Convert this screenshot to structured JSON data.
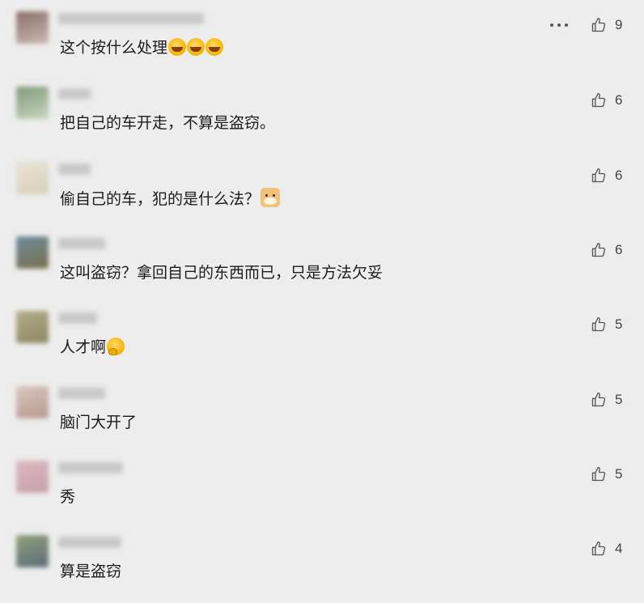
{
  "comments": [
    {
      "text": "这个按什么处理",
      "emojis": [
        "laugh",
        "laugh",
        "laugh"
      ],
      "likes": "9",
      "has_more": true,
      "avatar_colors": [
        "#8a6f6a",
        "#c9b8b0"
      ]
    },
    {
      "text": "把自己的车开走，不算是盗窃。",
      "emojis": [],
      "likes": "6",
      "has_more": false,
      "avatar_colors": [
        "#7f9a7a",
        "#c8d6c0"
      ]
    },
    {
      "text": "偷自己的车，犯的是什么法？",
      "emojis": [
        "dog"
      ],
      "likes": "6",
      "has_more": false,
      "avatar_colors": [
        "#e9e3d6",
        "#d8cfba"
      ]
    },
    {
      "text": "这叫盗窃？拿回自己的东西而已，只是方法欠妥",
      "emojis": [],
      "likes": "6",
      "has_more": false,
      "avatar_colors": [
        "#6c8aa0",
        "#7a7049"
      ]
    },
    {
      "text": "人才啊",
      "emojis": [
        "think"
      ],
      "likes": "5",
      "has_more": false,
      "avatar_colors": [
        "#b3ad8a",
        "#8d8662"
      ]
    },
    {
      "text": "脑门大开了",
      "emojis": [],
      "likes": "5",
      "has_more": false,
      "avatar_colors": [
        "#d9c5bd",
        "#b79a8f"
      ]
    },
    {
      "text": "秀",
      "emojis": [],
      "likes": "5",
      "has_more": false,
      "avatar_colors": [
        "#dcb8bf",
        "#c6a0a8"
      ]
    },
    {
      "text": "算是盗窃",
      "emojis": [],
      "likes": "4",
      "has_more": false,
      "avatar_colors": [
        "#8fa07a",
        "#5c6c7a"
      ]
    }
  ]
}
